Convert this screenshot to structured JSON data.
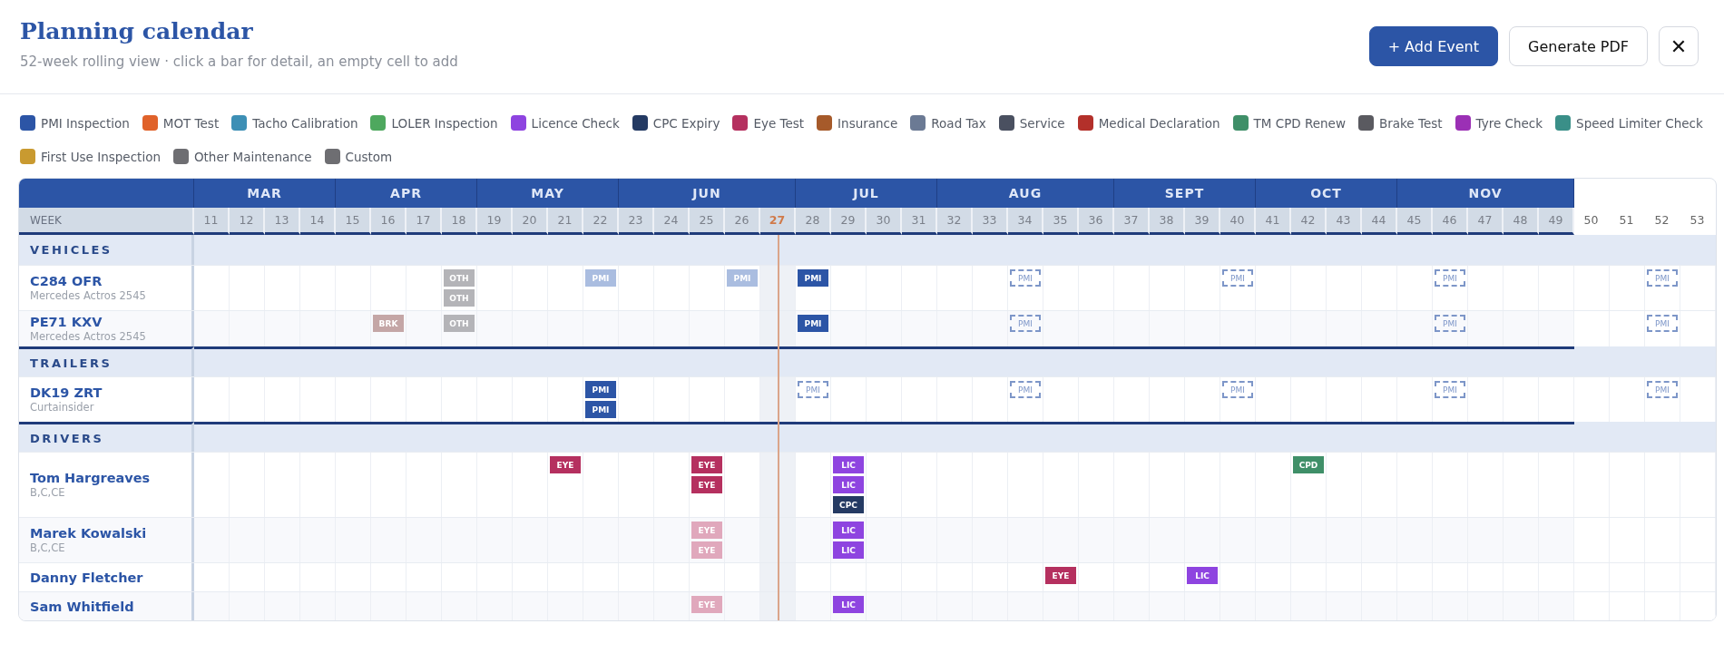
{
  "header": {
    "title": "Planning calendar",
    "subtitle": "52-week rolling view · click a bar for detail, an empty cell to add",
    "buttons": [
      {
        "label": "+ Add Event",
        "kind": "primary"
      },
      {
        "label": "Generate PDF",
        "kind": "secondary"
      },
      {
        "label": "✕",
        "kind": "close"
      }
    ]
  },
  "legend": [
    {
      "label": "PMI Inspection",
      "color": "#2c55a6"
    },
    {
      "label": "MOT Test",
      "color": "#e0622a"
    },
    {
      "label": "Tacho Calibration",
      "color": "#3d8fb5"
    },
    {
      "label": "LOLER Inspection",
      "color": "#4ea85e"
    },
    {
      "label": "Licence Check",
      "color": "#8e44e0"
    },
    {
      "label": "CPC Expiry",
      "color": "#243a63"
    },
    {
      "label": "Eye Test",
      "color": "#b5305f"
    },
    {
      "label": "Insurance",
      "color": "#a65a2a"
    },
    {
      "label": "Road Tax",
      "color": "#6b7a94"
    },
    {
      "label": "Service",
      "color": "#4a5060"
    },
    {
      "label": "Medical Declaration",
      "color": "#b3302a"
    },
    {
      "label": "TM CPD Renew",
      "color": "#3f8f68"
    },
    {
      "label": "Brake Test",
      "color": "#5a5a60"
    },
    {
      "label": "Tyre Check",
      "color": "#9b30b5"
    },
    {
      "label": "Speed Limiter Check",
      "color": "#3a8f88"
    },
    {
      "label": "First Use Inspection",
      "color": "#c99a30"
    },
    {
      "label": "Other Maintenance",
      "color": "#6e6e72"
    },
    {
      "label": "Custom",
      "color": "#6e6e72"
    }
  ],
  "calendar": {
    "corner": "WEEK",
    "months": [
      {
        "name": "MAR",
        "weeks": [
          {
            "label": "11",
            "current": false
          },
          {
            "label": "12",
            "current": false
          },
          {
            "label": "13",
            "current": false
          },
          {
            "label": "14",
            "current": false
          }
        ]
      },
      {
        "name": "APR",
        "weeks": [
          {
            "label": "15",
            "current": false
          },
          {
            "label": "16",
            "current": false
          },
          {
            "label": "17",
            "current": false
          },
          {
            "label": "18",
            "current": false
          }
        ]
      },
      {
        "name": "MAY",
        "weeks": [
          {
            "label": "19",
            "current": false
          },
          {
            "label": "20",
            "current": false
          },
          {
            "label": "21",
            "current": false
          },
          {
            "label": "22",
            "current": false
          }
        ]
      },
      {
        "name": "JUN",
        "weeks": [
          {
            "label": "23",
            "current": false
          },
          {
            "label": "24",
            "current": false
          },
          {
            "label": "25",
            "current": false
          },
          {
            "label": "26",
            "current": false
          },
          {
            "label": "27",
            "current": true
          }
        ]
      },
      {
        "name": "JUL",
        "weeks": [
          {
            "label": "28",
            "current": false
          },
          {
            "label": "29",
            "current": false
          },
          {
            "label": "30",
            "current": false
          },
          {
            "label": "31",
            "current": false
          }
        ]
      },
      {
        "name": "AUG",
        "weeks": [
          {
            "label": "32",
            "current": false
          },
          {
            "label": "33",
            "current": false
          },
          {
            "label": "34",
            "current": false
          },
          {
            "label": "35",
            "current": false
          },
          {
            "label": "36",
            "current": false
          }
        ]
      },
      {
        "name": "SEPT",
        "weeks": [
          {
            "label": "37",
            "current": false
          },
          {
            "label": "38",
            "current": false
          },
          {
            "label": "39",
            "current": false
          },
          {
            "label": "40",
            "current": false
          }
        ]
      },
      {
        "name": "OCT",
        "weeks": [
          {
            "label": "41",
            "current": false
          },
          {
            "label": "42",
            "current": false
          },
          {
            "label": "43",
            "current": false
          },
          {
            "label": "44",
            "current": false
          }
        ]
      },
      {
        "name": "NOV",
        "weeks": [
          {
            "label": "45",
            "current": false
          },
          {
            "label": "46",
            "current": false
          },
          {
            "label": "47",
            "current": false
          },
          {
            "label": "48",
            "current": false
          },
          {
            "label": "49",
            "current": false
          }
        ]
      },
      {
        "weeks": [
          {
            "label": "50",
            "current": false
          },
          {
            "label": "51",
            "current": false
          },
          {
            "label": "52",
            "current": false
          },
          {
            "label": "53",
            "current": false
          }
        ]
      }
    ],
    "sections": [
      {
        "title": "VEHICLES",
        "rows": [
          {
            "name": "C284 OFR",
            "sub": "Mercedes Actros 2545",
            "cells": [
              {},
              {},
              {},
              {},
              {},
              {},
              {},
              {
                "events": [
                  {
                    "label": "OTH",
                    "kind": "solid",
                    "color": "#b4b4b8"
                  },
                  {
                    "label": "OTH",
                    "kind": "solid",
                    "color": "#b4b4b8"
                  }
                ]
              },
              {},
              {},
              {},
              {
                "events": [
                  {
                    "label": "PMI",
                    "kind": "solid",
                    "color": "#aabde0"
                  }
                ]
              },
              {},
              {},
              {},
              {
                "events": [
                  {
                    "label": "PMI",
                    "kind": "solid",
                    "color": "#aabde0"
                  }
                ]
              },
              {},
              {
                "events": [
                  {
                    "label": "PMI",
                    "kind": "solid",
                    "color": "#2c55a6"
                  }
                ]
              },
              {},
              {},
              {},
              {},
              {},
              {
                "events": [
                  {
                    "label": "PMI",
                    "kind": "planned",
                    "color": "#7d96c8"
                  }
                ]
              },
              {},
              {},
              {},
              {},
              {},
              {
                "events": [
                  {
                    "label": "PMI",
                    "kind": "planned",
                    "color": "#7d96c8"
                  }
                ]
              },
              {},
              {},
              {},
              {},
              {},
              {
                "events": [
                  {
                    "label": "PMI",
                    "kind": "planned",
                    "color": "#7d96c8"
                  }
                ]
              },
              {},
              {},
              {},
              {},
              {},
              {
                "events": [
                  {
                    "label": "PMI",
                    "kind": "planned",
                    "color": "#7d96c8"
                  }
                ]
              },
              {}
            ]
          },
          {
            "name": "PE71 KXV",
            "sub": "Mercedes Actros 2545",
            "cells": [
              {},
              {},
              {},
              {},
              {},
              {
                "events": [
                  {
                    "label": "BRK",
                    "kind": "solid",
                    "color": "#c4a6a6"
                  }
                ]
              },
              {},
              {
                "events": [
                  {
                    "label": "OTH",
                    "kind": "solid",
                    "color": "#b4b4b8"
                  }
                ]
              },
              {},
              {},
              {},
              {},
              {},
              {},
              {},
              {},
              {},
              {
                "events": [
                  {
                    "label": "PMI",
                    "kind": "solid",
                    "color": "#2c55a6"
                  }
                ]
              },
              {},
              {},
              {},
              {},
              {},
              {
                "events": [
                  {
                    "label": "PMI",
                    "kind": "planned",
                    "color": "#7d96c8"
                  }
                ]
              },
              {},
              {},
              {},
              {},
              {},
              {},
              {},
              {},
              {},
              {},
              {},
              {
                "events": [
                  {
                    "label": "PMI",
                    "kind": "planned",
                    "color": "#7d96c8"
                  }
                ]
              },
              {},
              {},
              {},
              {},
              {},
              {
                "events": [
                  {
                    "label": "PMI",
                    "kind": "planned",
                    "color": "#7d96c8"
                  }
                ]
              },
              {}
            ]
          }
        ]
      },
      {
        "title": "TRAILERS",
        "rows": [
          {
            "name": "DK19 ZRT",
            "sub": "Curtainsider",
            "cells": [
              {},
              {},
              {},
              {},
              {},
              {},
              {},
              {},
              {},
              {},
              {},
              {
                "events": [
                  {
                    "label": "PMI",
                    "kind": "solid",
                    "color": "#2c55a6"
                  },
                  {
                    "label": "PMI",
                    "kind": "solid",
                    "color": "#2c55a6"
                  }
                ]
              },
              {},
              {},
              {},
              {},
              {},
              {
                "events": [
                  {
                    "label": "PMI",
                    "kind": "planned",
                    "color": "#7d96c8"
                  }
                ]
              },
              {},
              {},
              {},
              {},
              {},
              {
                "events": [
                  {
                    "label": "PMI",
                    "kind": "planned",
                    "color": "#7d96c8"
                  }
                ]
              },
              {},
              {},
              {},
              {},
              {},
              {
                "events": [
                  {
                    "label": "PMI",
                    "kind": "planned",
                    "color": "#7d96c8"
                  }
                ]
              },
              {},
              {},
              {},
              {},
              {},
              {
                "events": [
                  {
                    "label": "PMI",
                    "kind": "planned",
                    "color": "#7d96c8"
                  }
                ]
              },
              {},
              {},
              {},
              {},
              {},
              {
                "events": [
                  {
                    "label": "PMI",
                    "kind": "planned",
                    "color": "#7d96c8"
                  }
                ]
              },
              {}
            ]
          }
        ]
      },
      {
        "title": "DRIVERS",
        "rows": [
          {
            "name": "Tom Hargreaves",
            "sub": "B,C,CE",
            "cells": [
              {},
              {},
              {},
              {},
              {},
              {},
              {},
              {},
              {},
              {},
              {
                "events": [
                  {
                    "label": "EYE",
                    "kind": "solid",
                    "color": "#b5305f"
                  }
                ]
              },
              {},
              {},
              {},
              {
                "events": [
                  {
                    "label": "EYE",
                    "kind": "solid",
                    "color": "#b5305f"
                  },
                  {
                    "label": "EYE",
                    "kind": "solid",
                    "color": "#b5305f"
                  }
                ]
              },
              {},
              {},
              {},
              {
                "events": [
                  {
                    "label": "LIC",
                    "kind": "solid",
                    "color": "#8e44e0"
                  },
                  {
                    "label": "LIC",
                    "kind": "solid",
                    "color": "#8e44e0"
                  },
                  {
                    "label": "CPC",
                    "kind": "solid",
                    "color": "#243a63"
                  }
                ]
              },
              {},
              {},
              {},
              {},
              {},
              {},
              {},
              {},
              {},
              {},
              {},
              {},
              {
                "events": [
                  {
                    "label": "CPD",
                    "kind": "solid",
                    "color": "#3f8f68"
                  }
                ]
              },
              {},
              {},
              {},
              {},
              {},
              {},
              {},
              {},
              {},
              {},
              {}
            ]
          },
          {
            "name": "Marek Kowalski",
            "sub": "B,C,CE",
            "cells": [
              {},
              {},
              {},
              {},
              {},
              {},
              {},
              {},
              {},
              {},
              {},
              {},
              {},
              {},
              {
                "events": [
                  {
                    "label": "EYE",
                    "kind": "solid",
                    "color": "#e0a8bc"
                  },
                  {
                    "label": "EYE",
                    "kind": "solid",
                    "color": "#e0a8bc"
                  }
                ]
              },
              {},
              {},
              {},
              {
                "events": [
                  {
                    "label": "LIC",
                    "kind": "solid",
                    "color": "#8e44e0"
                  },
                  {
                    "label": "LIC",
                    "kind": "solid",
                    "color": "#8e44e0"
                  }
                ]
              },
              {},
              {},
              {},
              {},
              {},
              {},
              {},
              {},
              {},
              {},
              {},
              {},
              {},
              {},
              {},
              {},
              {},
              {},
              {},
              {},
              {},
              {},
              {},
              {}
            ]
          },
          {
            "name": "Danny Fletcher",
            "cells": [
              {},
              {},
              {},
              {},
              {},
              {},
              {},
              {},
              {},
              {},
              {},
              {},
              {},
              {},
              {},
              {},
              {},
              {},
              {},
              {},
              {},
              {},
              {},
              {},
              {
                "events": [
                  {
                    "label": "EYE",
                    "kind": "solid",
                    "color": "#b5305f"
                  }
                ]
              },
              {},
              {},
              {},
              {
                "events": [
                  {
                    "label": "LIC",
                    "kind": "solid",
                    "color": "#8e44e0"
                  }
                ]
              },
              {},
              {},
              {},
              {},
              {},
              {},
              {},
              {},
              {},
              {},
              {},
              {},
              {},
              {}
            ]
          },
          {
            "name": "Sam Whitfield",
            "cells": [
              {},
              {},
              {},
              {},
              {},
              {},
              {},
              {},
              {},
              {},
              {},
              {},
              {},
              {},
              {
                "events": [
                  {
                    "label": "EYE",
                    "kind": "solid",
                    "color": "#e0a8bc"
                  }
                ]
              },
              {},
              {},
              {},
              {
                "events": [
                  {
                    "label": "LIC",
                    "kind": "solid",
                    "color": "#8e44e0"
                  }
                ]
              },
              {},
              {},
              {},
              {},
              {},
              {},
              {},
              {},
              {},
              {},
              {},
              {},
              {},
              {},
              {},
              {},
              {},
              {},
              {},
              {},
              {},
              {},
              {},
              {}
            ]
          }
        ]
      }
    ]
  }
}
